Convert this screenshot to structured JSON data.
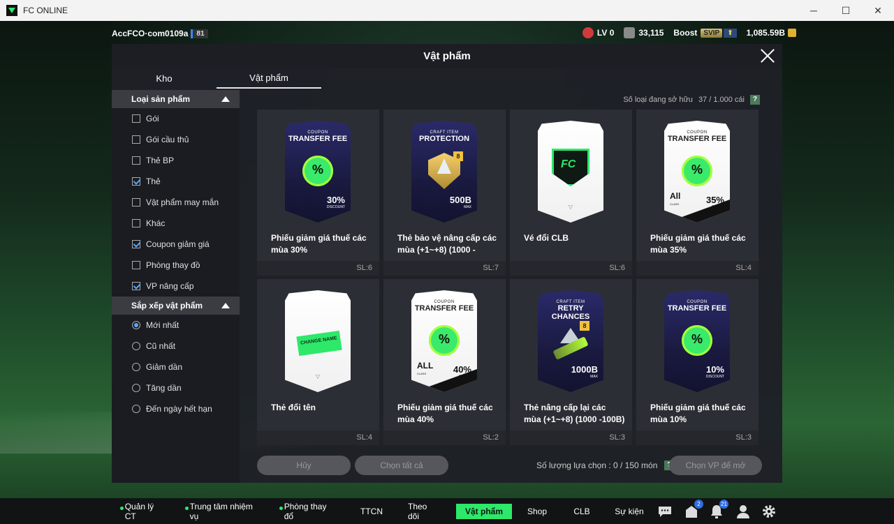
{
  "window": {
    "title": "FC ONLINE",
    "minimize": "─",
    "maximize": "☐",
    "close": "✕"
  },
  "topbar": {
    "account": "AccFCO·com0109a",
    "account_level": "81",
    "lv": "LV 0",
    "points": "33,115",
    "boost": "Boost",
    "svip": "SVIP",
    "svip_arrow": "⬆",
    "bp": "1,085.59B"
  },
  "modal": {
    "title": "Vật phẩm",
    "tabs": [
      "Kho",
      "Vật phẩm"
    ],
    "owned_label": "Số loại đang sở hữu",
    "owned_value": "37 / 1.000 cái",
    "help": "?"
  },
  "filters": {
    "type_header": "Loại sản phẩm",
    "types": [
      {
        "label": "Gói",
        "checked": false
      },
      {
        "label": "Gói cầu thủ",
        "checked": false
      },
      {
        "label": "Thẻ BP",
        "checked": false
      },
      {
        "label": "Thẻ",
        "checked": true
      },
      {
        "label": "Vật phẩm may mắn",
        "checked": false
      },
      {
        "label": "Khác",
        "checked": false
      },
      {
        "label": "Coupon giảm giá",
        "checked": true
      },
      {
        "label": "Phòng thay đồ",
        "checked": false
      },
      {
        "label": "VP nâng cấp",
        "checked": true
      }
    ],
    "sort_header": "Sắp xếp vật phẩm",
    "sorts": [
      {
        "label": "Mới nhất",
        "checked": true
      },
      {
        "label": "Cũ nhất",
        "checked": false
      },
      {
        "label": "Giảm dần",
        "checked": false
      },
      {
        "label": "Tăng dần",
        "checked": false
      },
      {
        "label": "Đến ngày hết hạn",
        "checked": false
      }
    ]
  },
  "items": [
    {
      "name": "Phiếu giảm giá thuế các mùa 30%",
      "qty": "SL:6",
      "art": {
        "style": "dark",
        "small": "COUPON",
        "big": "TRANSFER FEE",
        "value": "30%",
        "unit": "DISCOUNT",
        "emblem": "coupon"
      }
    },
    {
      "name": "Thẻ bảo vệ nâng cấp các mùa (+1~+8) (1000 -",
      "qty": "SL:7",
      "art": {
        "style": "dark",
        "small": "CRAFT ITEM",
        "big": "PROTECTION",
        "value": "500B",
        "unit": "MAX",
        "emblem": "protection",
        "badge": "8"
      }
    },
    {
      "name": "Vé đổi CLB",
      "qty": "SL:6",
      "art": {
        "style": "white",
        "emblem": "club"
      }
    },
    {
      "name": "Phiếu giảm giá thuế các mùa 35%",
      "qty": "SL:4",
      "art": {
        "style": "white",
        "small": "COUPON",
        "big": "TRANSFER FEE",
        "value": "35%",
        "unit": "BONUS",
        "emblem": "coupon",
        "all": "All",
        "all_small": "CLASS"
      }
    },
    {
      "name": "Thẻ đổi tên",
      "qty": "SL:4",
      "art": {
        "style": "white",
        "emblem": "name",
        "tag": "CHANGE NAME"
      }
    },
    {
      "name": "Phiếu giảm giá thuế các mùa 40%",
      "qty": "SL:2",
      "art": {
        "style": "white",
        "small": "COUPON",
        "big": "TRANSFER FEE",
        "value": "40%",
        "unit": "BONUS",
        "emblem": "coupon",
        "all": "ALL",
        "all_small": "CLASS"
      }
    },
    {
      "name": "Thẻ nâng cấp lại các mùa (+1~+8) (1000 -100B)",
      "qty": "SL:3",
      "art": {
        "style": "dark",
        "small": "CRAFT ITEM",
        "big": "RETRY CHANCES",
        "value": "1000B",
        "unit": "MAX",
        "emblem": "retry",
        "badge": "8"
      }
    },
    {
      "name": "Phiếu giảm giá thuế các mùa 10%",
      "qty": "SL:3",
      "art": {
        "style": "dark",
        "small": "COUPON",
        "big": "TRANSFER FEE",
        "value": "10%",
        "unit": "DISCOUNT",
        "emblem": "coupon"
      }
    }
  ],
  "actions": {
    "cancel": "Hủy",
    "select_all": "Chọn tất cả",
    "selected_label": "Số lượng lựa chọn : 0 / 150 món",
    "open": "Chọn VP để mở"
  },
  "nav": {
    "items": [
      "Quản lý CT",
      "Trung tâm nhiệm vụ",
      "Phòng thay đổ",
      "TTCN",
      "Theo dõi",
      "Vật phẩm",
      "Shop",
      "CLB",
      "Sự kiện"
    ],
    "badge_mail": "2",
    "badge_notify": "21"
  },
  "colors": {
    "accent": "#2ee86a",
    "check": "#58a8ff"
  }
}
